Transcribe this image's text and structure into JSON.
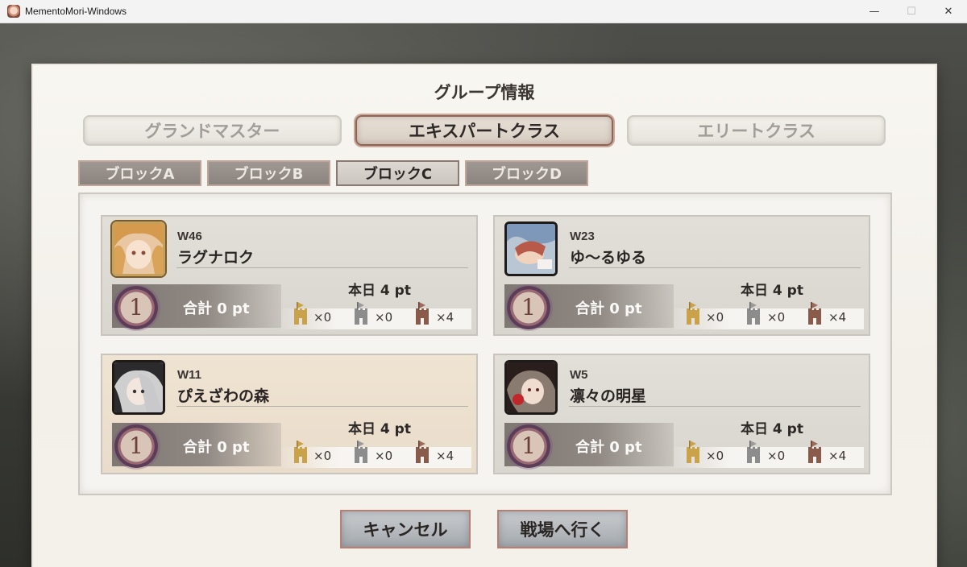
{
  "window": {
    "title": "MementoMori-Windows",
    "minimize_glyph": "—",
    "maximize_glyph": "☐",
    "close_glyph": "✕"
  },
  "dialog": {
    "title": "グループ情報",
    "class_tabs": [
      {
        "label": "グランドマスター",
        "active": false
      },
      {
        "label": "エキスパートクラス",
        "active": true
      },
      {
        "label": "エリートクラス",
        "active": false
      }
    ],
    "block_tabs": [
      {
        "label": "ブロックA",
        "active": false
      },
      {
        "label": "ブロックB",
        "active": false
      },
      {
        "label": "ブロックC",
        "active": true
      },
      {
        "label": "ブロックD",
        "active": false
      }
    ],
    "groups": [
      {
        "world": "W46",
        "name": "ラグナロク",
        "rank": "1",
        "total": "合計 0 pt",
        "today": "本日 4 pt",
        "towers": [
          {
            "color": "gold",
            "count": "×0"
          },
          {
            "color": "gray",
            "count": "×0"
          },
          {
            "color": "brown",
            "count": "×4"
          }
        ]
      },
      {
        "world": "W23",
        "name": "ゆ〜るゆる",
        "rank": "1",
        "total": "合計 0 pt",
        "today": "本日 4 pt",
        "towers": [
          {
            "color": "gold",
            "count": "×0"
          },
          {
            "color": "gray",
            "count": "×0"
          },
          {
            "color": "brown",
            "count": "×4"
          }
        ]
      },
      {
        "world": "W11",
        "name": "ぴえざわの森",
        "rank": "1",
        "total": "合計 0 pt",
        "today": "本日 4 pt",
        "towers": [
          {
            "color": "gold",
            "count": "×0"
          },
          {
            "color": "gray",
            "count": "×0"
          },
          {
            "color": "brown",
            "count": "×4"
          }
        ]
      },
      {
        "world": "W5",
        "name": "凛々の明星",
        "rank": "1",
        "total": "合計 0 pt",
        "today": "本日 4 pt",
        "towers": [
          {
            "color": "gold",
            "count": "×0"
          },
          {
            "color": "gray",
            "count": "×0"
          },
          {
            "color": "brown",
            "count": "×4"
          }
        ]
      }
    ],
    "buttons": {
      "cancel": "キャンセル",
      "go": "戦場へ行く"
    }
  },
  "colors": {
    "accent": "#8e6456",
    "tower_gold": "#c9a24a",
    "tower_gray": "#8c8c8c",
    "tower_brown": "#8a5a4a"
  }
}
